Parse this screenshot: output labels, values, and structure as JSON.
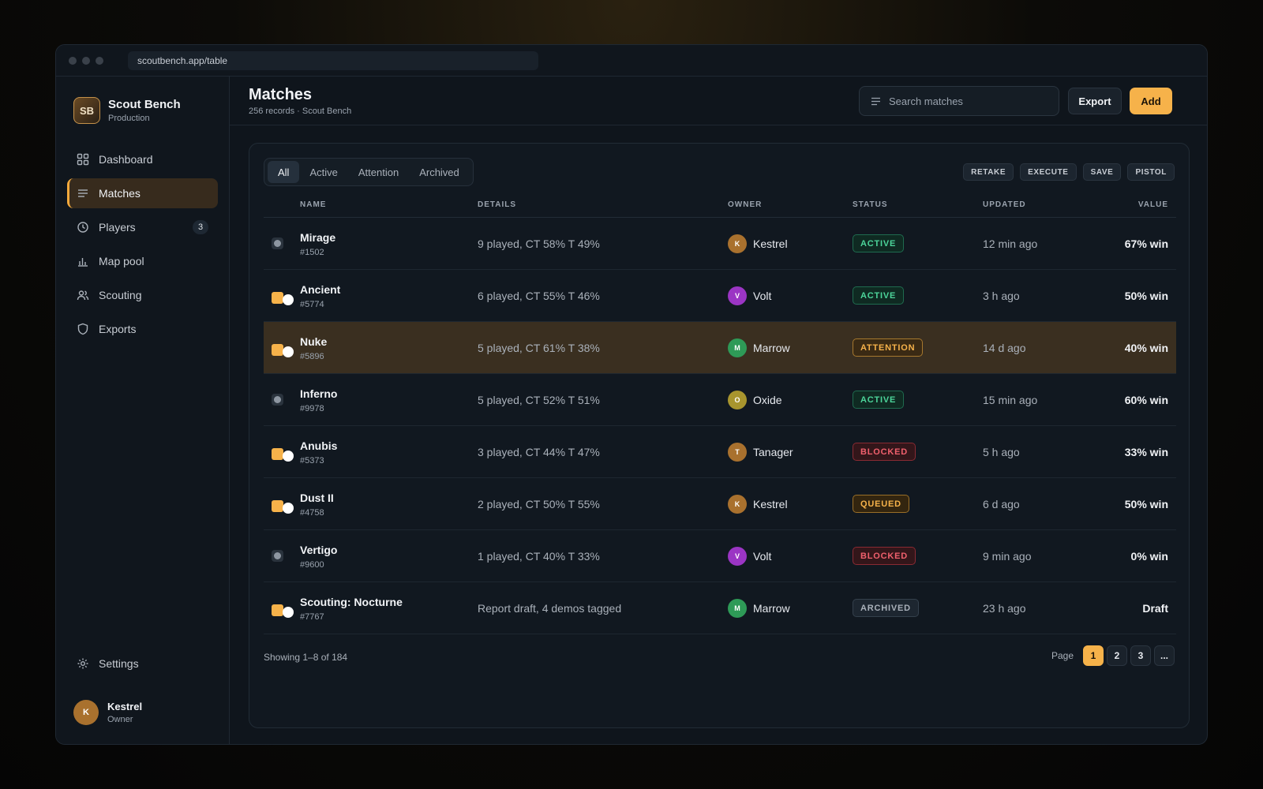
{
  "browser": {
    "url": "scoutbench.app/table"
  },
  "brand": {
    "initials": "SB",
    "name": "Scout Bench",
    "env": "Production"
  },
  "nav": {
    "items": [
      {
        "label": "Dashboard",
        "icon": "dashboard-icon"
      },
      {
        "label": "Matches",
        "icon": "list-icon",
        "active": true
      },
      {
        "label": "Players",
        "icon": "clock-icon",
        "badge": "3"
      },
      {
        "label": "Map pool",
        "icon": "bar-chart-icon"
      },
      {
        "label": "Scouting",
        "icon": "users-icon"
      },
      {
        "label": "Exports",
        "icon": "shield-icon"
      }
    ],
    "settings_label": "Settings"
  },
  "user": {
    "initial": "K",
    "name": "Kestrel",
    "role": "Owner"
  },
  "header": {
    "title": "Matches",
    "subtitle": "256 records · Scout Bench",
    "search_placeholder": "Search matches",
    "export_label": "Export",
    "add_label": "Add"
  },
  "filters": {
    "tabs": [
      "All",
      "Active",
      "Attention",
      "Archived"
    ],
    "active": "All"
  },
  "chips": [
    "RETAKE",
    "EXECUTE",
    "SAVE",
    "PISTOL"
  ],
  "table": {
    "columns": {
      "name": "NAME",
      "details": "DETAILS",
      "owner": "OWNER",
      "status": "STATUS",
      "updated": "UPDATED",
      "value": "VALUE"
    },
    "rows": [
      {
        "name": "Mirage",
        "id": "#1502",
        "details": "9 played, CT 58% T 49%",
        "owner": "Kestrel",
        "owner_initial": "K",
        "owner_color": "#a9712e",
        "status": "ACTIVE",
        "status_kind": "active",
        "updated": "12 min ago",
        "value": "67% win",
        "selector": "grey"
      },
      {
        "name": "Ancient",
        "id": "#5774",
        "details": "6 played, CT 55% T 46%",
        "owner": "Volt",
        "owner_initial": "V",
        "owner_color": "#9b35c4",
        "status": "ACTIVE",
        "status_kind": "active",
        "updated": "3 h ago",
        "value": "50% win",
        "selector": "toggle"
      },
      {
        "name": "Nuke",
        "id": "#5896",
        "details": "5 played, CT 61% T 38%",
        "owner": "Marrow",
        "owner_initial": "M",
        "owner_color": "#2e9a57",
        "status": "ATTENTION",
        "status_kind": "attention",
        "updated": "14 d ago",
        "value": "40% win",
        "selector": "toggle",
        "highlight": true
      },
      {
        "name": "Inferno",
        "id": "#9978",
        "details": "5 played, CT 52% T 51%",
        "owner": "Oxide",
        "owner_initial": "O",
        "owner_color": "#a8952e",
        "status": "ACTIVE",
        "status_kind": "active",
        "updated": "15 min ago",
        "value": "60% win",
        "selector": "grey"
      },
      {
        "name": "Anubis",
        "id": "#5373",
        "details": "3 played, CT 44% T 47%",
        "owner": "Tanager",
        "owner_initial": "T",
        "owner_color": "#a9712e",
        "status": "BLOCKED",
        "status_kind": "blocked",
        "updated": "5 h ago",
        "value": "33% win",
        "selector": "toggle"
      },
      {
        "name": "Dust II",
        "id": "#4758",
        "details": "2 played, CT 50% T 55%",
        "owner": "Kestrel",
        "owner_initial": "K",
        "owner_color": "#a9712e",
        "status": "QUEUED",
        "status_kind": "queued",
        "updated": "6 d ago",
        "value": "50% win",
        "selector": "toggle"
      },
      {
        "name": "Vertigo",
        "id": "#9600",
        "details": "1 played, CT 40% T 33%",
        "owner": "Volt",
        "owner_initial": "V",
        "owner_color": "#9b35c4",
        "status": "BLOCKED",
        "status_kind": "blocked",
        "updated": "9 min ago",
        "value": "0% win",
        "selector": "grey"
      },
      {
        "name": "Scouting: Nocturne",
        "id": "#7767",
        "details": "Report draft, 4 demos tagged",
        "owner": "Marrow",
        "owner_initial": "M",
        "owner_color": "#2e9a57",
        "status": "ARCHIVED",
        "status_kind": "archived",
        "updated": "23 h ago",
        "value": "Draft",
        "selector": "toggle"
      }
    ]
  },
  "footer": {
    "showing": "Showing 1–8 of 184",
    "page_label": "Page",
    "pages": [
      "1",
      "2",
      "3",
      "..."
    ],
    "current_page": "1"
  }
}
